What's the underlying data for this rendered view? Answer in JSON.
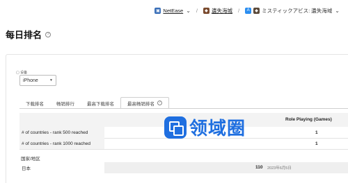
{
  "breadcrumb": {
    "publisher": "NetEase",
    "game_cn": "遺失海城",
    "game_full": "ミスティックアビス: 遺失海域",
    "separator": "/"
  },
  "page": {
    "title": "每日排名",
    "help_icon": "?"
  },
  "filters": {
    "device_label": "设备",
    "device_value": "iPhone"
  },
  "tabs": [
    {
      "label": "下载排名"
    },
    {
      "label": "畅销排行"
    },
    {
      "label": "最高下载排名"
    },
    {
      "label": "最高畅销排名",
      "active": true
    }
  ],
  "table": {
    "column_header": "Role Playing (Games)",
    "rows": [
      {
        "label": "# of countries - rank 500 reached",
        "value": "1"
      },
      {
        "label": "# of countries - rank 1000 reached",
        "value": "1"
      }
    ],
    "section_label": "国家/地区",
    "countries": [
      {
        "name": "日本",
        "rank": "110",
        "date": "2023年6月5日"
      }
    ]
  },
  "watermark": {
    "text": "领域圈"
  },
  "colors": {
    "accent": "#1f6fe0",
    "stripe": "#f3f3f3"
  }
}
